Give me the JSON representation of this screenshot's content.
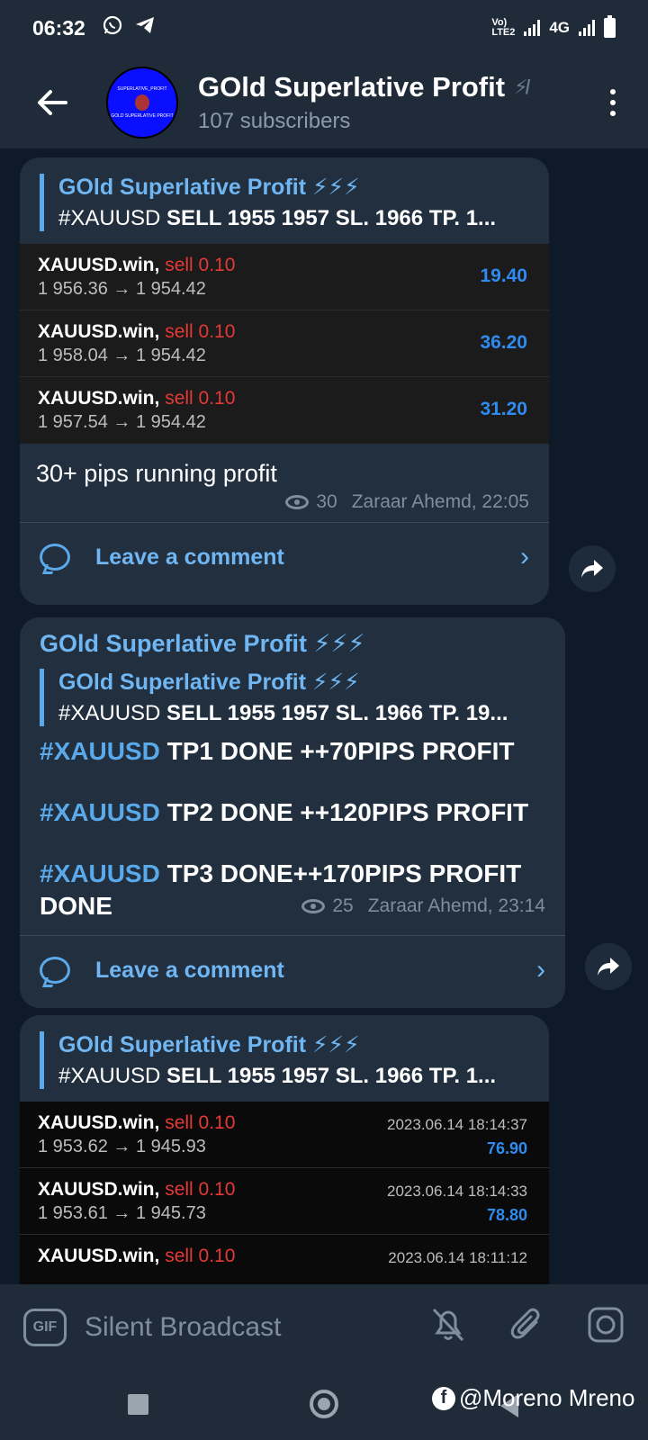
{
  "status_bar": {
    "time": "06:32",
    "network": "4G",
    "lte": "Vo) LTE2"
  },
  "header": {
    "title": "GOld Superlative Profit",
    "subscribers": "107 subscribers",
    "avatar_text_top": "SUPERLATIVE_PROFIT",
    "avatar_text_bottom": "GOLD SUPERLATIVE PROFIT"
  },
  "messages": [
    {
      "reply": {
        "name": "GOld Superlative Profit ⚡⚡⚡",
        "text_tag": "#XAUUSD ",
        "text_body": "SELL 1955 1957  SL. 1966  TP. 1..."
      },
      "trades": [
        {
          "symbol": "XAUUSD.win, ",
          "side": "sell 0.10",
          "prices": "1 956.36 → 1 954.42",
          "profit": "19.40"
        },
        {
          "symbol": "XAUUSD.win, ",
          "side": "sell 0.10",
          "prices": "1 958.04 → 1 954.42",
          "profit": "36.20"
        },
        {
          "symbol": "XAUUSD.win, ",
          "side": "sell 0.10",
          "prices": "1 957.54 → 1 954.42",
          "profit": "31.20"
        }
      ],
      "text": "30+ pips running profit",
      "views": "30",
      "author_time": "Zaraar Ahemd, 22:05",
      "comment_label": "Leave a comment"
    },
    {
      "sender": "GOld Superlative Profit ⚡⚡⚡",
      "reply": {
        "name": "GOld Superlative Profit ⚡⚡⚡",
        "text_tag": "#XAUUSD ",
        "text_body": "SELL 1955 1957  SL. 1966  TP. 19..."
      },
      "lines": [
        {
          "tag": "#XAUUSD",
          "text": " TP1 DONE ++70PIPS PROFIT"
        },
        {
          "tag": "#XAUUSD",
          "text": " TP2 DONE ++120PIPS PROFIT"
        },
        {
          "tag": "#XAUUSD",
          "text": " TP3 DONE++170PIPS PROFIT"
        }
      ],
      "last_word": "DONE",
      "views": "25",
      "author_time": "Zaraar Ahemd, 23:14",
      "comment_label": "Leave a comment"
    },
    {
      "reply": {
        "name": "GOld Superlative Profit ⚡⚡⚡",
        "text_tag": "#XAUUSD ",
        "text_body": "SELL 1955 1957  SL. 1966  TP. 1..."
      },
      "trades": [
        {
          "symbol": "XAUUSD.win, ",
          "side": "sell 0.10",
          "prices": "1 953.62 → 1 945.93",
          "date": "2023.06.14 18:14:37",
          "profit": "76.90"
        },
        {
          "symbol": "XAUUSD.win, ",
          "side": "sell 0.10",
          "prices": "1 953.61 → 1 945.73",
          "date": "2023.06.14 18:14:33",
          "profit": "78.80"
        },
        {
          "symbol": "XAUUSD.win, ",
          "side": "sell 0.10",
          "prices": "",
          "date": "2023.06.14 18:11:12",
          "profit": ""
        }
      ]
    }
  ],
  "input": {
    "gif_label": "GIF",
    "placeholder": "Silent Broadcast"
  },
  "watermark": "@Moreno Mreno",
  "colors": {
    "accent": "#6fb6f2",
    "bubble": "#212f3f",
    "sell": "#e53935",
    "profit": "#2e8cf0"
  }
}
